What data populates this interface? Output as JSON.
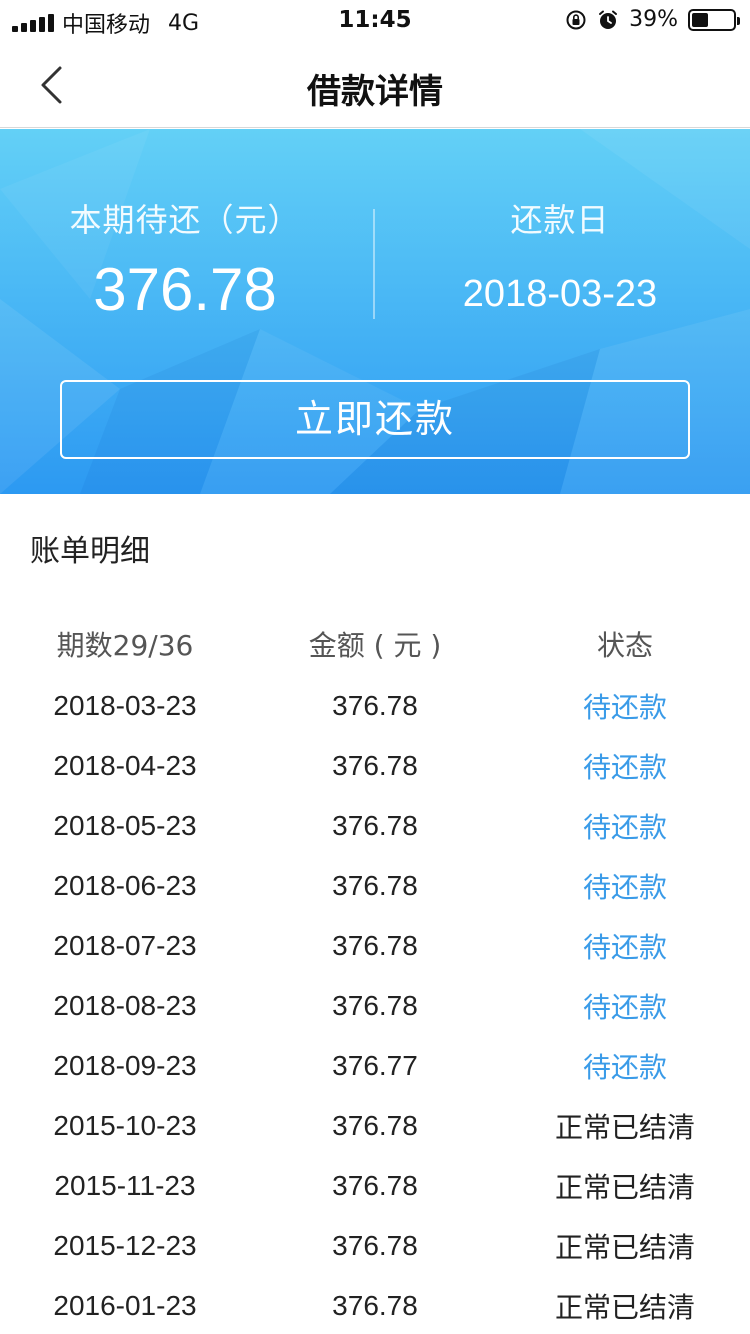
{
  "status_bar": {
    "carrier": "中国移动",
    "network": "4G",
    "time": "11:45",
    "battery_text": "39%",
    "battery_level": 0.39,
    "icons": [
      "signal-icon",
      "orientation-lock-icon",
      "alarm-icon",
      "battery-icon"
    ]
  },
  "nav": {
    "title": "借款详情",
    "back_icon": "chevron-left-icon"
  },
  "hero": {
    "due_label": "本期待还（元）",
    "due_amount": "376.78",
    "date_label": "还款日",
    "date_value": "2018-03-23",
    "repay_button": "立即还款",
    "colors": {
      "top": "#63d0f6",
      "bottom": "#2c99f2"
    }
  },
  "bill": {
    "section_title": "账单明细",
    "headers": {
      "period": "期数29/36",
      "amount": "金额 ( 元 )",
      "status": "状态"
    },
    "rows": [
      {
        "date": "2018-03-23",
        "amount": "376.78",
        "status": "待还款",
        "pending": true
      },
      {
        "date": "2018-04-23",
        "amount": "376.78",
        "status": "待还款",
        "pending": true
      },
      {
        "date": "2018-05-23",
        "amount": "376.78",
        "status": "待还款",
        "pending": true
      },
      {
        "date": "2018-06-23",
        "amount": "376.78",
        "status": "待还款",
        "pending": true
      },
      {
        "date": "2018-07-23",
        "amount": "376.78",
        "status": "待还款",
        "pending": true
      },
      {
        "date": "2018-08-23",
        "amount": "376.78",
        "status": "待还款",
        "pending": true
      },
      {
        "date": "2018-09-23",
        "amount": "376.77",
        "status": "待还款",
        "pending": true
      },
      {
        "date": "2015-10-23",
        "amount": "376.78",
        "status": "正常已结清",
        "pending": false
      },
      {
        "date": "2015-11-23",
        "amount": "376.78",
        "status": "正常已结清",
        "pending": false
      },
      {
        "date": "2015-12-23",
        "amount": "376.78",
        "status": "正常已结清",
        "pending": false
      },
      {
        "date": "2016-01-23",
        "amount": "376.78",
        "status": "正常已结清",
        "pending": false
      }
    ],
    "colors": {
      "pending": "#3a9be8",
      "done": "#222222"
    }
  }
}
